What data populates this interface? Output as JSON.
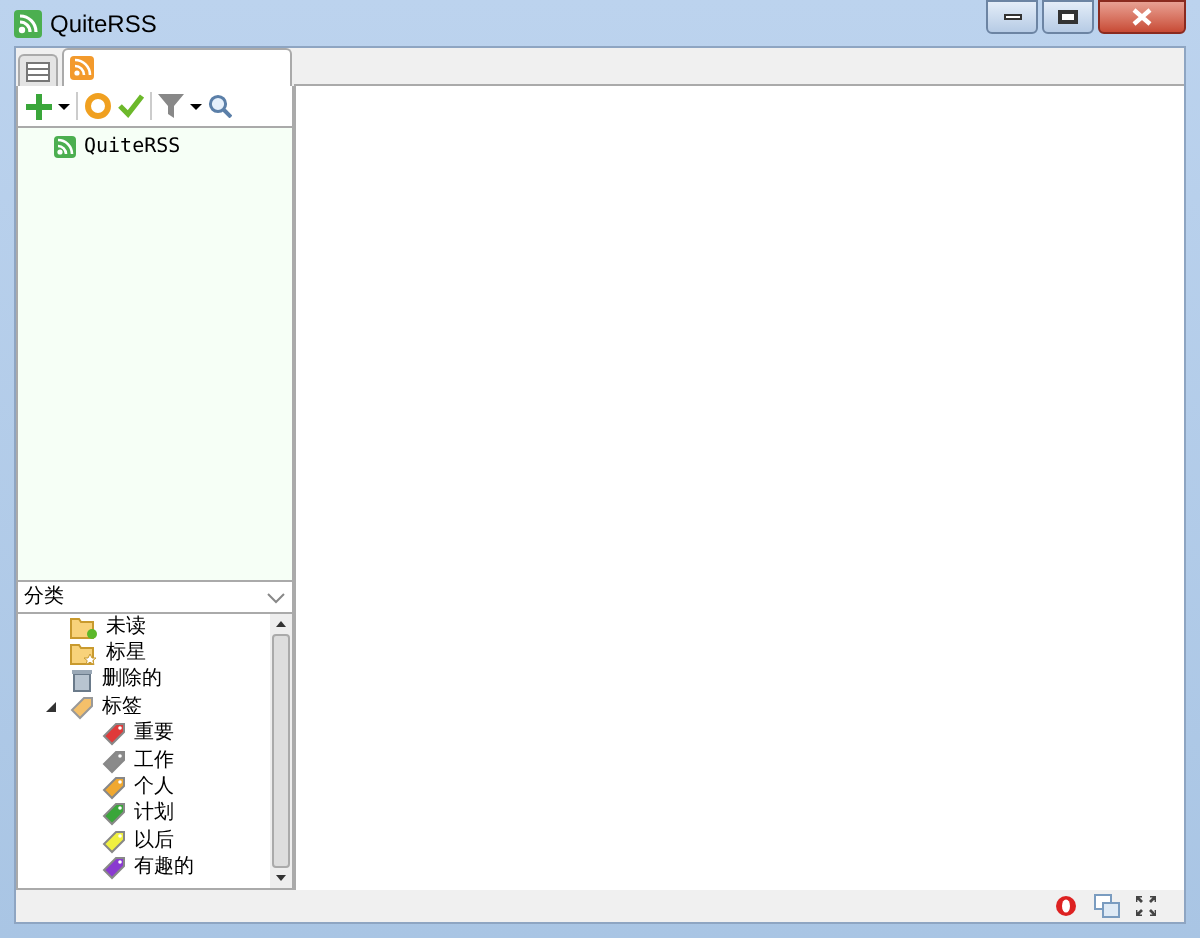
{
  "window": {
    "title": "QuiteRSS"
  },
  "tabs": [
    {
      "kind": "list",
      "selected": false
    },
    {
      "kind": "feed",
      "selected": true
    }
  ],
  "feeds": [
    {
      "title": "QuiteRSS"
    }
  ],
  "categories": {
    "header": "分类",
    "items": [
      {
        "label": "未读",
        "kind": "unread"
      },
      {
        "label": "标星",
        "kind": "starred"
      },
      {
        "label": "删除的",
        "kind": "deleted"
      },
      {
        "label": "标签",
        "kind": "labels",
        "expanded": true,
        "children": [
          {
            "label": "重要",
            "color": "#e03a3a"
          },
          {
            "label": "工作",
            "color": "#8a8a8a"
          },
          {
            "label": "个人",
            "color": "#f0a830"
          },
          {
            "label": "计划",
            "color": "#3aa63a"
          },
          {
            "label": "以后",
            "color": "#f0f040"
          },
          {
            "label": "有趣的",
            "color": "#8a3ad0"
          }
        ]
      }
    ]
  }
}
